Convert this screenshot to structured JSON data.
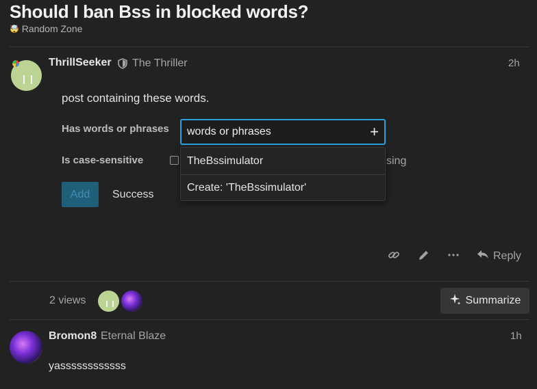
{
  "topic": {
    "title": "Should I ban Bss in blocked words?",
    "category_emoji": "🤯",
    "category": "Random Zone"
  },
  "post1": {
    "username": "ThrillSeeker",
    "flair_icon": "shield-icon",
    "user_title": "The Thriller",
    "age": "2h",
    "body_partial": "post containing these words.",
    "label_words": "Has words or phrases",
    "input_value": "words or phrases",
    "add_icon": "+",
    "label_case": "Is case-sensitive",
    "case_tail": "sing",
    "dropdown_options": [
      "TheBssimulator",
      "Create: 'TheBssimulator'"
    ],
    "add_button": "Add",
    "status": "Success",
    "actions": {
      "link_icon": "link-icon",
      "edit_icon": "pencil-icon",
      "more_icon": "ellipsis-icon",
      "reply_label": "Reply"
    }
  },
  "topic_map": {
    "views": "2 views",
    "summarize_label": "Summarize"
  },
  "post2": {
    "username": "Bromon8",
    "user_title": "Eternal Blaze",
    "age": "1h",
    "body": "yassssssssssss"
  },
  "colors": {
    "background": "#222222",
    "accent": "#28a3e0",
    "add_button_bg": "#1f5f7a"
  }
}
